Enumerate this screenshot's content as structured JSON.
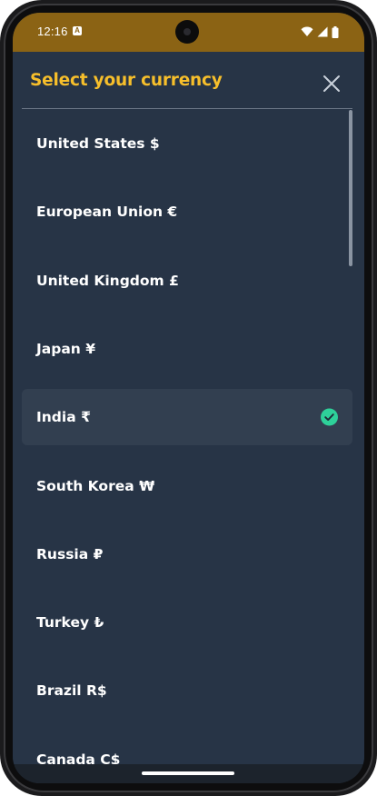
{
  "status_bar": {
    "time": "12:16",
    "notification_glyph": "A",
    "icons": [
      "wifi-icon",
      "signal-icon",
      "battery-icon"
    ]
  },
  "sheet": {
    "title": "Select your currency",
    "close_icon": "close-icon"
  },
  "currencies": [
    {
      "label": "United States $",
      "selected": false
    },
    {
      "label": "European Union €",
      "selected": false
    },
    {
      "label": "United Kingdom £",
      "selected": false
    },
    {
      "label": "Japan ¥",
      "selected": false
    },
    {
      "label": "India ₹",
      "selected": true
    },
    {
      "label": "South Korea ₩",
      "selected": false
    },
    {
      "label": "Russia ₽",
      "selected": false
    },
    {
      "label": "Turkey ₺",
      "selected": false
    },
    {
      "label": "Brazil R$",
      "selected": false
    },
    {
      "label": "Canada C$",
      "selected": false
    }
  ],
  "colors": {
    "status_bar_bg": "#8b6314",
    "sheet_bg": "#273446",
    "title": "#f7bf2b",
    "selected_row_bg": "#323f50",
    "check": "#2ed19a"
  }
}
